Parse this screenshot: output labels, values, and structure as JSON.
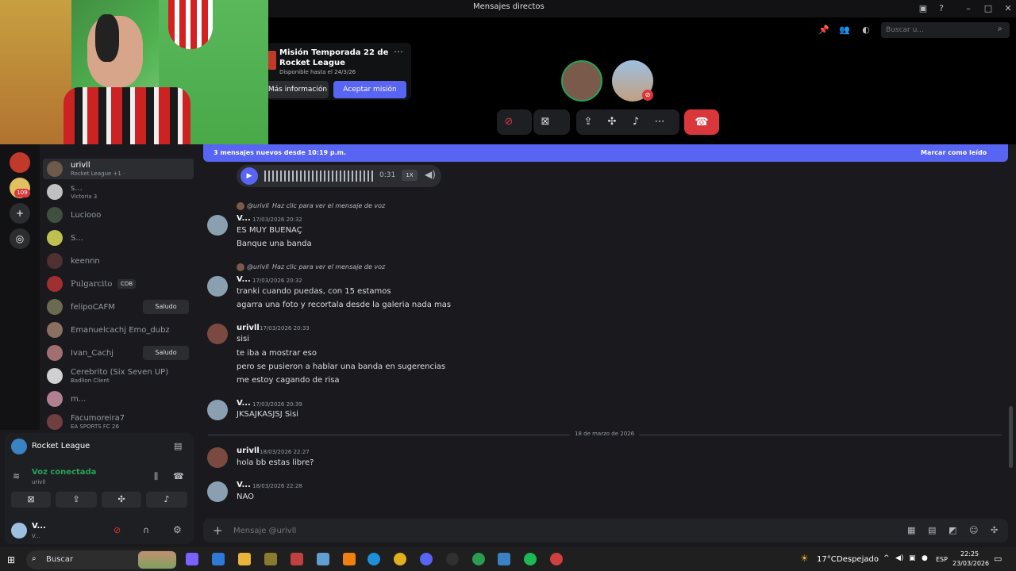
{
  "window": {
    "title": "Mensajes directos",
    "search_placeholder": "Buscar u..."
  },
  "quest": {
    "title": "Misión Temporada 22 de Rocket League",
    "subtitle": "Disponible hasta el 24/3/26",
    "more_label": "Más información",
    "accept_label": "Aceptar misión"
  },
  "new_messages": {
    "text": "3 mensajes nuevos desde 10:19 p.m.",
    "action": "Marcar como leído"
  },
  "voice_message": {
    "duration": "0:31",
    "speed": "1X"
  },
  "dms": [
    {
      "name": "urivll",
      "status": "Rocket League +1 · ",
      "active": true
    },
    {
      "name": "s...",
      "status": "Victoria 3"
    },
    {
      "name": "Luciooo",
      "status": ""
    },
    {
      "name": "S...",
      "status": ""
    },
    {
      "name": "keennn",
      "status": ""
    },
    {
      "name": "Pulgarcito",
      "status": "",
      "tag": "COB"
    },
    {
      "name": "felipoCAFM",
      "status": "",
      "button": "Saludo"
    },
    {
      "name": "Emanuelcachj Emo_dubz",
      "status": ""
    },
    {
      "name": "Ivan_Cachj",
      "status": "",
      "button": "Saludo"
    },
    {
      "name": "Cerebrito (Six Seven UP)",
      "status": "Badlion Client"
    },
    {
      "name": "m...",
      "status": ""
    },
    {
      "name": "Facumoreira7",
      "status": "EA SPORTS FC 26"
    }
  ],
  "voice_panel": {
    "game": "Rocket League",
    "status": "Voz conectada",
    "user": "urivll",
    "self_name": "V...",
    "self_sub": "V..."
  },
  "messages": [
    {
      "reply_from": "@urivll",
      "reply_text": "Haz clic para ver el mensaje de voz",
      "author": "V...",
      "time": "17/03/2026 20:32",
      "lines": [
        "ES MUY BUENAÇ",
        "Banque una banda"
      ]
    },
    {
      "reply_from": "@urivll",
      "reply_text": "Haz clic para ver el mensaje de voz",
      "author": "V...",
      "time": "17/03/2026 20:32",
      "lines": [
        "tranki cuando puedas, con 15 estamos",
        "agarra una foto y recortala desde la galeria nada mas"
      ]
    },
    {
      "author": "urivll",
      "time": "17/03/2026 20:33",
      "lines": [
        "sisi",
        "te iba a mostrar eso",
        "pero se pusieron a hablar una banda en sugerencias",
        "me estoy cagando de risa"
      ]
    },
    {
      "author": "V...",
      "time": "17/03/2026 20:39",
      "lines": [
        "JKSAJKASJSJ Sisi"
      ]
    },
    {
      "author": "urivll",
      "time": "18/03/2026 22:27",
      "lines": [
        "hola bb estas libre?"
      ]
    },
    {
      "author": "V...",
      "time": "18/03/2026 22:28",
      "lines": [
        "NAO"
      ]
    }
  ],
  "date_divider": "18 de marzo de 2026",
  "composer": {
    "placeholder": "Mensaje @urivll"
  },
  "taskbar": {
    "search": "Buscar",
    "weather_temp": "17°C",
    "weather_text": "Despejado",
    "lang": "ESP",
    "time": "22:25",
    "date": "23/03/2026"
  }
}
